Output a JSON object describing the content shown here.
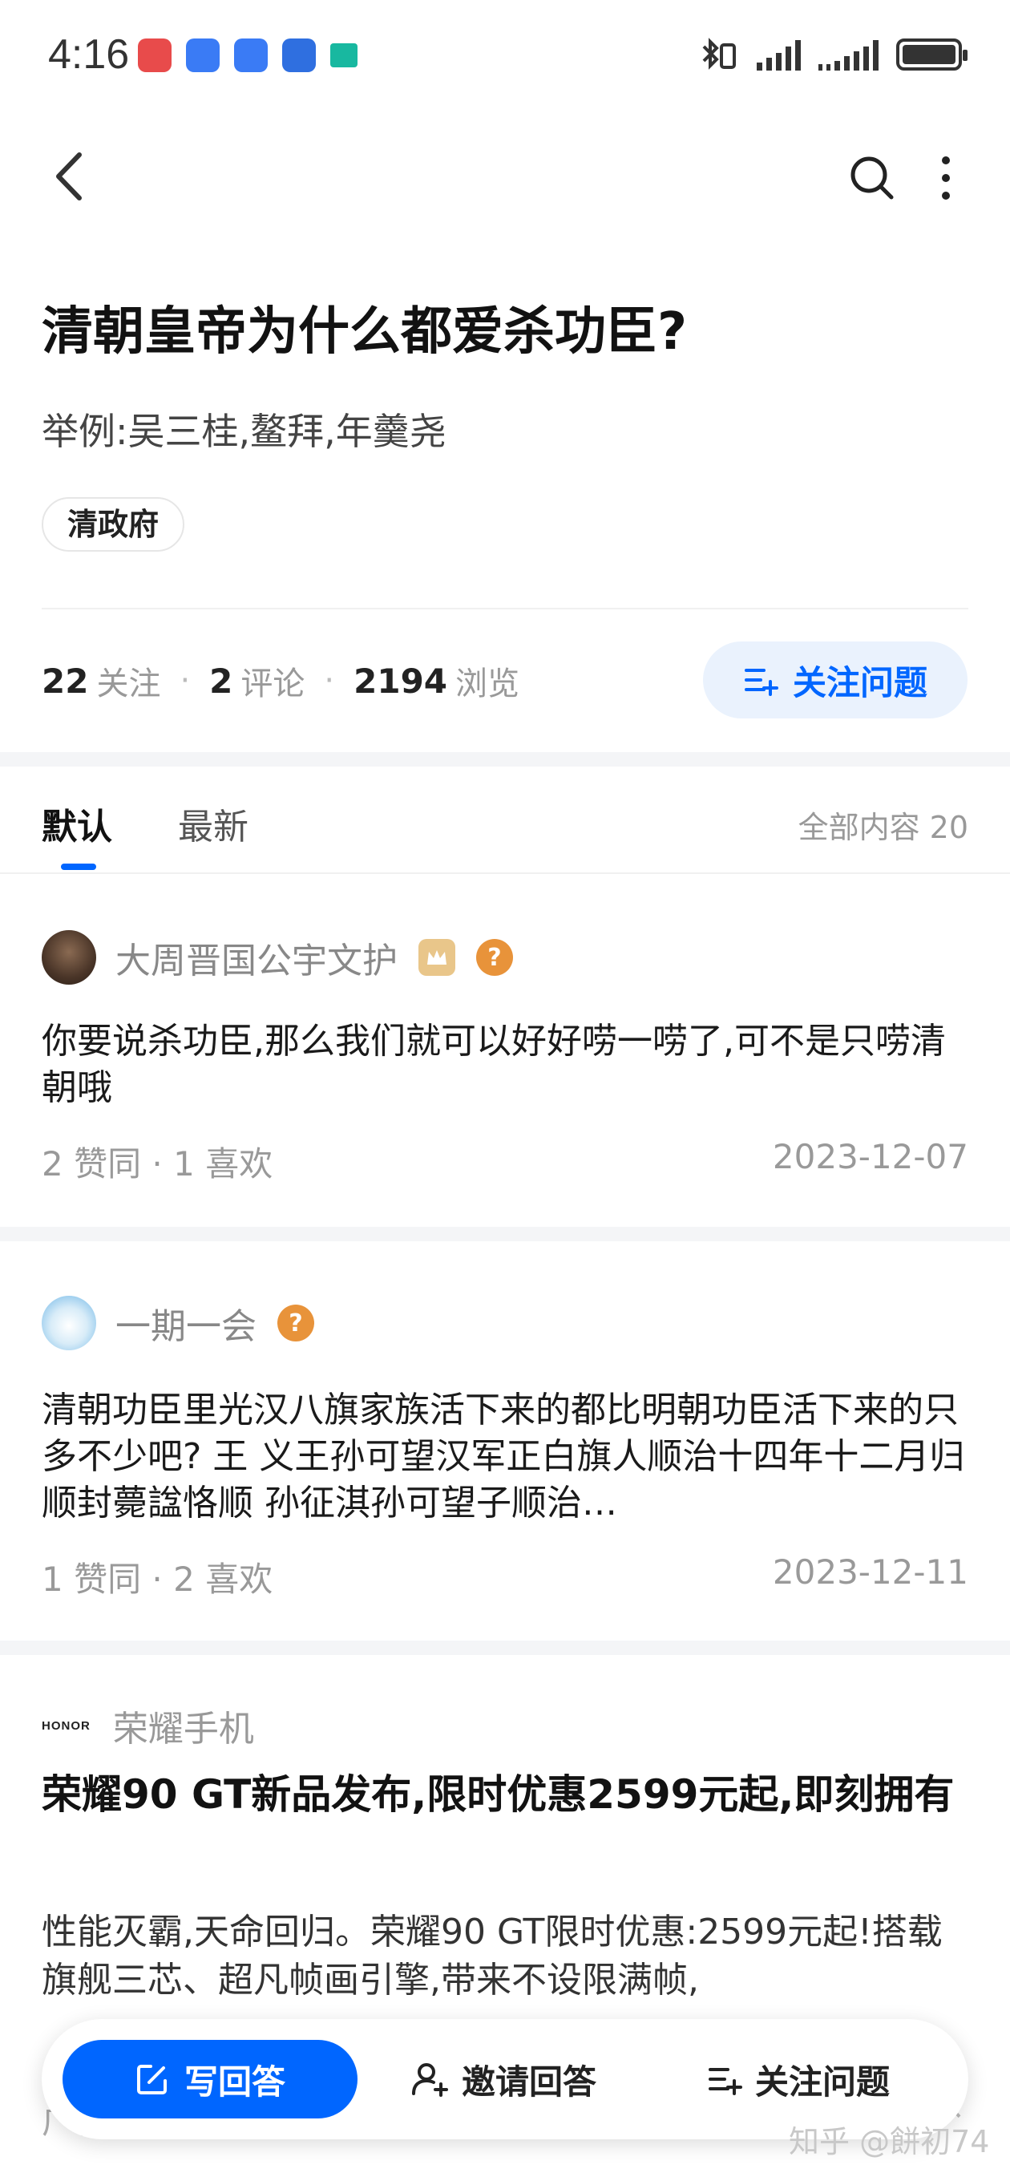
{
  "status_bar": {
    "time": "4:16",
    "app_icon_colors": [
      "#e84b4b",
      "#3a7bf5",
      "#3a7bf5",
      "#2f6fe0",
      "#18b8a0"
    ]
  },
  "question": {
    "title": "清朝皇帝为什么都爱杀功臣?",
    "detail": "举例:吴三桂,鳌拜,年羹尧",
    "tag": "清政府"
  },
  "stats": {
    "followers": "22",
    "followers_label": "关注",
    "comments": "2",
    "comments_label": "评论",
    "views": "2194",
    "views_label": "浏览",
    "separator": "·",
    "follow_button": "关注问题"
  },
  "tabs": {
    "default": "默认",
    "latest": "最新",
    "total": "全部内容 20"
  },
  "answers": [
    {
      "author": "大周晋国公宇文护",
      "text": "你要说杀功臣,那么我们就可以好好唠一唠了,可不是只唠清朝哦",
      "meta": "2 赞同 · 1 喜欢",
      "date": "2023-12-07"
    },
    {
      "author": "一期一会",
      "text": "清朝功臣里光汉八旗家族活下来的都比明朝功臣活下来的只多不少吧? 王 义王孙可望汉军正白旗人顺治十四年十二月归顺封薨諡恪顺 孙征淇孙可望子顺治…",
      "meta": "1 赞同 · 2 喜欢",
      "date": "2023-12-11"
    }
  ],
  "ad": {
    "logo": "HONOR",
    "brand": "荣耀手机",
    "title": "荣耀90 GT新品发布,限时优惠2599元起,即刻拥有",
    "desc": "性能灭霸,天命回归。荣耀90 GT限时优惠:2599元起!搭载旗舰三芯、超凡帧画引擎,带来不设限满帧,",
    "footer": "广告 · 立即打开",
    "close": "✕"
  },
  "bottom_bar": {
    "write": "写回答",
    "invite": "邀请回答",
    "follow": "关注问题"
  },
  "watermark": "知乎 @餅初74",
  "colors": {
    "accent": "#0066ff",
    "accent_light": "#eaf2fd"
  }
}
